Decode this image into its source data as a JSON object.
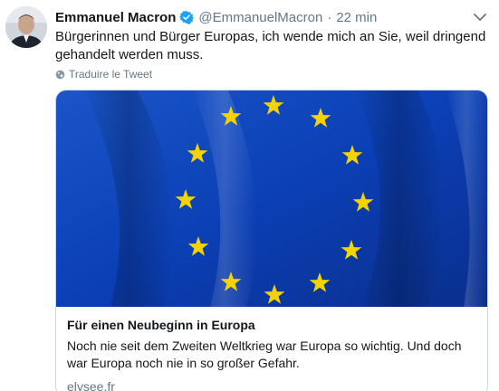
{
  "author": {
    "name": "Emmanuel Macron",
    "handle": "@EmmanuelMacron",
    "separator": "·",
    "time": "22 min"
  },
  "tweet": {
    "text": "Bürgerinnen und Bürger Europas, ich wende mich an Sie, weil dringend gehandelt werden muss.",
    "translate_label": "Traduire le Tweet"
  },
  "card": {
    "title": "Für einen Neubeginn in Europa",
    "description": "Noch nie seit dem Zweiten Weltkrieg war Europa so wichtig. Und doch war Europa noch nie in so großer Gefahr.",
    "domain": "elysee.fr"
  },
  "colors": {
    "verified": "#1da1f2",
    "flag_blue": "#0b3fb5",
    "flag_star": "#f5d300",
    "secondary_text": "#657786"
  },
  "icons": {
    "verified": "verified-badge-icon",
    "caret": "chevron-down-icon",
    "translate": "globe-icon"
  }
}
